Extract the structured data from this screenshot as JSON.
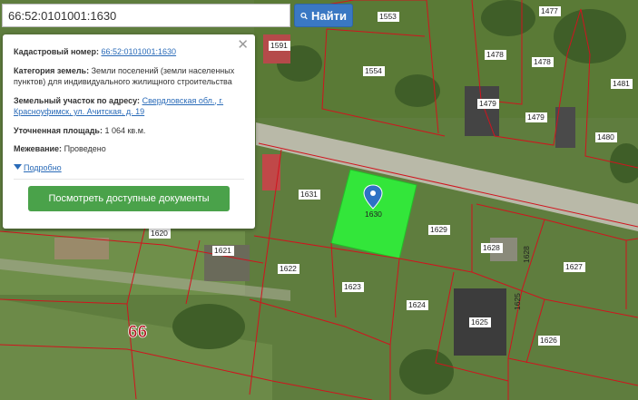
{
  "search": {
    "value": "66:52:0101001:1630",
    "button_label": "Найти"
  },
  "info": {
    "cadastral_label": "Кадастровый номер:",
    "cadastral_value": "66:52:0101001:1630",
    "category_label": "Категория земель:",
    "category_value": "Земли поселений (земли населенных пунктов) для индивидуального жилищного строительства",
    "address_label": "Земельный участок по адресу:",
    "address_value": "Свердловская обл., г. Красноуфимск, ул. Ачитская, д. 19",
    "area_label": "Уточненная площадь:",
    "area_value": "1 064 кв.м.",
    "survey_label": "Межевание:",
    "survey_value": "Проведено",
    "more_label": "Подробно",
    "docs_button": "Посмотреть доступные документы"
  },
  "map": {
    "region_label": "66",
    "highlight_color": "#33e63a",
    "parcels": {
      "p1553": "1553",
      "p1477": "1477",
      "p1591": "1591",
      "p1554": "1554",
      "p1478": "1478",
      "p1478b": "1478",
      "p1481": "1481",
      "p1479": "1479",
      "p1479b": "1479",
      "p1480": "1480",
      "p1631": "1631",
      "p1630": "1630",
      "p1629": "1629",
      "p1628": "1628",
      "p1628b": "1628",
      "p1620": "1620",
      "p1621": "1621",
      "p1622": "1622",
      "p1623": "1623",
      "p1624": "1624",
      "p1625": "1625",
      "p1625b": "1625",
      "p1627": "1627",
      "p1626": "1626"
    }
  }
}
